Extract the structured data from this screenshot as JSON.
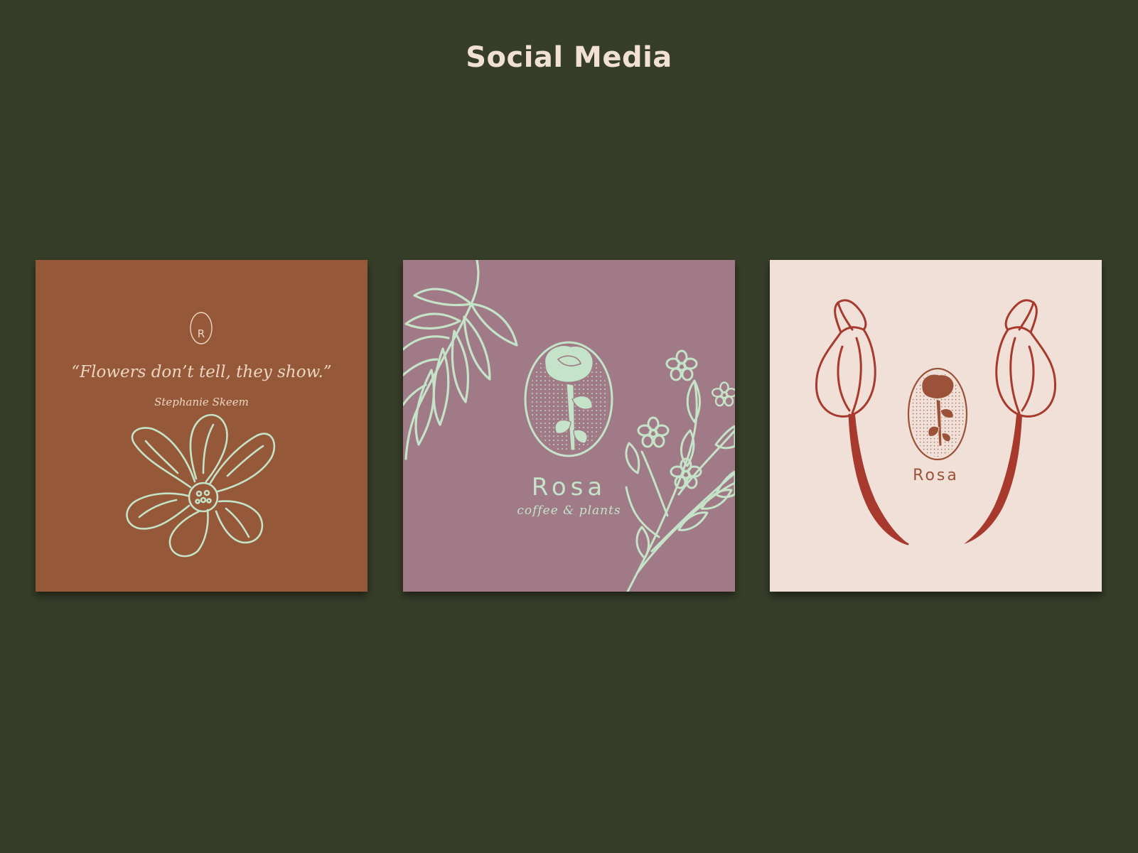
{
  "page": {
    "title": "Social Media"
  },
  "colors": {
    "background": "#363d28",
    "title": "#f1e0d4",
    "card1_bg": "#955838",
    "card2_bg": "#a07a86",
    "card3_bg": "#f0e0d8",
    "mint": "#c4e3c8",
    "card1_text": "#ecd6c2",
    "rust": "#a8392d",
    "brown": "#9c5238"
  },
  "cards": [
    {
      "monogram": "R",
      "quote": "“Flowers don’t tell, they show.”",
      "author": "Stephanie Skeem",
      "icons": [
        "monogram-badge-icon",
        "flower-illustration-icon"
      ]
    },
    {
      "brand": "Rosa",
      "tagline": "coffee & plants",
      "icons": [
        "rose-oval-logo-icon",
        "fern-leaf-icon",
        "wildflower-branch-icon"
      ]
    },
    {
      "brand": "Rosa",
      "icons": [
        "tulip-left-icon",
        "tulip-right-icon",
        "rose-oval-logo-icon"
      ]
    }
  ]
}
